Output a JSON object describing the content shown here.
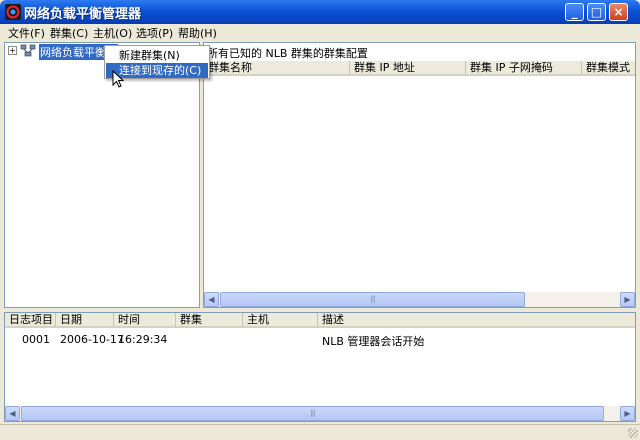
{
  "window": {
    "title": "网络负载平衡管理器"
  },
  "menubar": {
    "items": [
      "文件(F)",
      "群集(C)",
      "主机(O)",
      "选项(P)",
      "帮助(H)"
    ]
  },
  "tree": {
    "root_label": "网络负载平衡群"
  },
  "context_menu": {
    "items": [
      "新建群集(N)",
      "连接到现存的(C)"
    ],
    "highlighted_index": 1
  },
  "cluster_list": {
    "caption": "所有已知的 NLB 群集的群集配置",
    "columns": [
      "群集名称",
      "群集 IP 地址",
      "群集 IP 子网掩码",
      "群集模式"
    ]
  },
  "log": {
    "columns": [
      "日志项目",
      "日期",
      "时间",
      "群集",
      "主机",
      "描述"
    ],
    "rows": [
      {
        "entry": "0001",
        "date": "2006-10-17",
        "time": "16:29:34",
        "cluster": "",
        "host": "",
        "description": "NLB 管理器会话开始"
      }
    ]
  },
  "colors": {
    "titlebar": "#0a52d6",
    "selection": "#316ac5",
    "chrome": "#ece9d8",
    "close_button": "#c9401d"
  }
}
